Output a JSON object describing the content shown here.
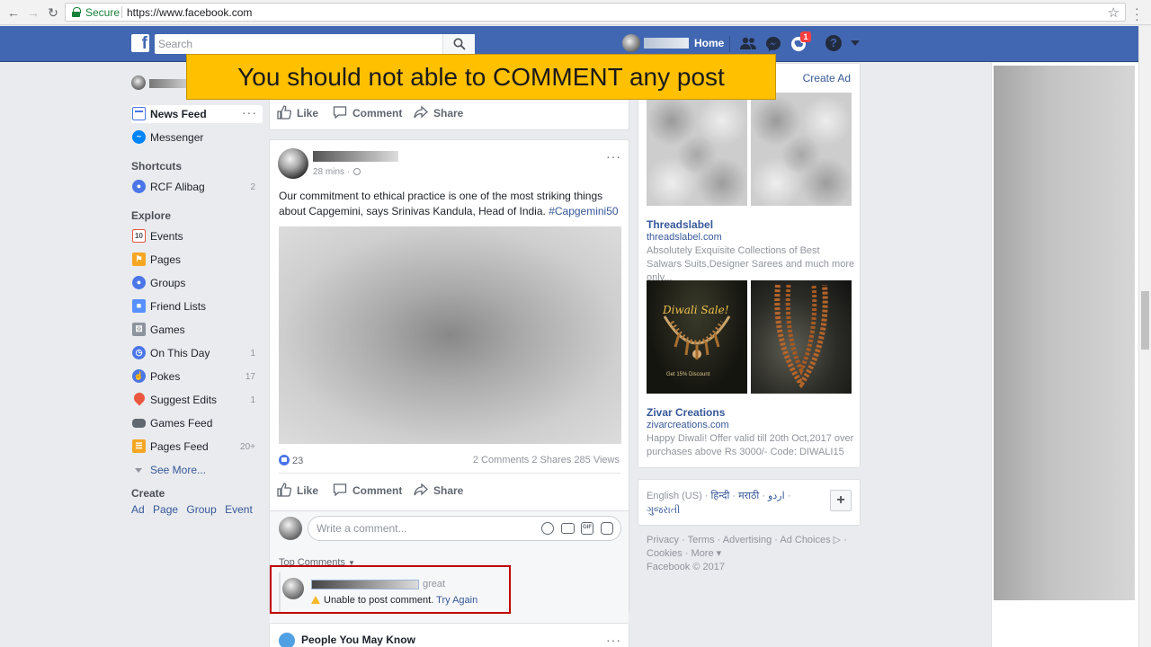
{
  "browser": {
    "secure_label": "Secure",
    "url": "https://www.facebook.com"
  },
  "header": {
    "search_placeholder": "Search",
    "home_label": "Home",
    "notification_count": "1",
    "help_label": "?",
    "logo_letter": "f",
    "brand_color": "#4267b2"
  },
  "left_nav": {
    "items": [
      {
        "label": "News Feed",
        "count": "",
        "icon": "news-feed-icon",
        "active": true
      },
      {
        "label": "Messenger",
        "count": "",
        "icon": "messenger-icon"
      }
    ],
    "shortcuts_title": "Shortcuts",
    "shortcuts": [
      {
        "label": "RCF Alibag",
        "count": "2",
        "icon": "group-icon"
      }
    ],
    "explore_title": "Explore",
    "explore": [
      {
        "label": "Events",
        "count": "",
        "icon": "calendar-icon",
        "glyph": "10"
      },
      {
        "label": "Pages",
        "count": "",
        "icon": "flag-icon"
      },
      {
        "label": "Groups",
        "count": "",
        "icon": "groups-icon"
      },
      {
        "label": "Friend Lists",
        "count": "",
        "icon": "friend-lists-icon"
      },
      {
        "label": "Games",
        "count": "",
        "icon": "games-icon"
      },
      {
        "label": "On This Day",
        "count": "1",
        "icon": "clock-icon"
      },
      {
        "label": "Pokes",
        "count": "17",
        "icon": "poke-icon"
      },
      {
        "label": "Suggest Edits",
        "count": "1",
        "icon": "map-pin-icon"
      },
      {
        "label": "Games Feed",
        "count": "",
        "icon": "controller-icon"
      },
      {
        "label": "Pages Feed",
        "count": "20+",
        "icon": "pages-feed-icon"
      }
    ],
    "see_more": "See More...",
    "create_title": "Create",
    "create_links": [
      "Ad",
      "Page",
      "Group",
      "Event"
    ]
  },
  "post_actions": {
    "like": "Like",
    "comment": "Comment",
    "share": "Share"
  },
  "post": {
    "time": "28 mins",
    "text": "Our commitment to ethical practice is one of the most striking things about Capgemini, says Srinivas Kandula, Head of India.",
    "hashtag": "#Capgemini50",
    "reaction_count": "23",
    "comments": "2 Comments",
    "shares": "2 Shares",
    "views": "285 Views",
    "comment_placeholder": "Write a comment...",
    "top_comments_label": "Top Comments",
    "failed_comment_text": "great",
    "error_text": "Unable to post comment.",
    "try_again": "Try Again"
  },
  "pymk": {
    "title": "People You May Know"
  },
  "ads": {
    "create_ad": "Create Ad",
    "items": [
      {
        "title": "Threadslabel",
        "domain": "threadslabel.com",
        "description": "Absolutely Exquisite Collections of Best Salwars Suits,Designer Sarees and much more only..."
      },
      {
        "title": "Zivar Creations",
        "domain": "zivarcreations.com",
        "description": "Happy Diwali! Offer valid till 20th Oct,2017 over purchases above Rs 3000/- Code: DIWALI15",
        "image_text": "Diwali Sale!",
        "image_subtext": "Get 15% Discount"
      }
    ]
  },
  "languages": {
    "current": "English (US)",
    "others": [
      "हिन्दी",
      "मराठी",
      "اردو",
      "ગુજરાતી"
    ],
    "add_label": "+"
  },
  "footer": {
    "links": [
      "Privacy",
      "Terms",
      "Advertising",
      "Ad Choices",
      "Cookies",
      "More"
    ],
    "copyright": "Facebook © 2017"
  },
  "overlay": {
    "banner_text": "You should not able to COMMENT any post",
    "banner_color": "#ffc000",
    "highlight_color": "#c00000"
  }
}
